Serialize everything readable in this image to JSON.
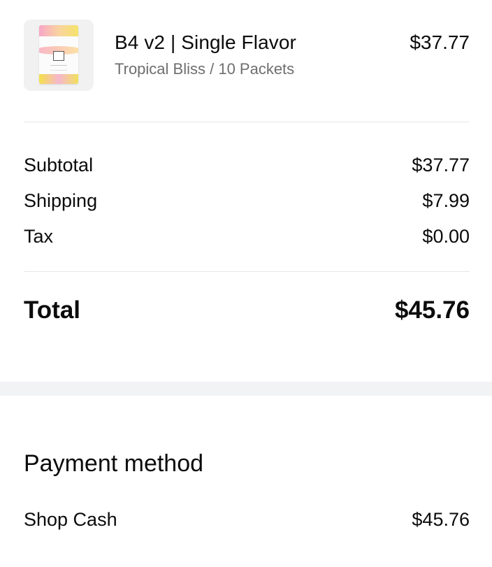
{
  "product": {
    "name": "B4 v2 | Single Flavor",
    "variant": "Tropical Bliss / 10 Packets",
    "price": "$37.77",
    "image_icon": "product-pouch-image"
  },
  "summary": {
    "subtotal_label": "Subtotal",
    "subtotal_value": "$37.77",
    "shipping_label": "Shipping",
    "shipping_value": "$7.99",
    "tax_label": "Tax",
    "tax_value": "$0.00",
    "total_label": "Total",
    "total_value": "$45.76"
  },
  "payment": {
    "title": "Payment method",
    "method_label": "Shop Cash",
    "method_amount": "$45.76"
  },
  "colors": {
    "text": "#0b0b0b",
    "muted": "#6e6e6e",
    "divider": "#e6e6e6",
    "band": "#f2f3f5"
  }
}
